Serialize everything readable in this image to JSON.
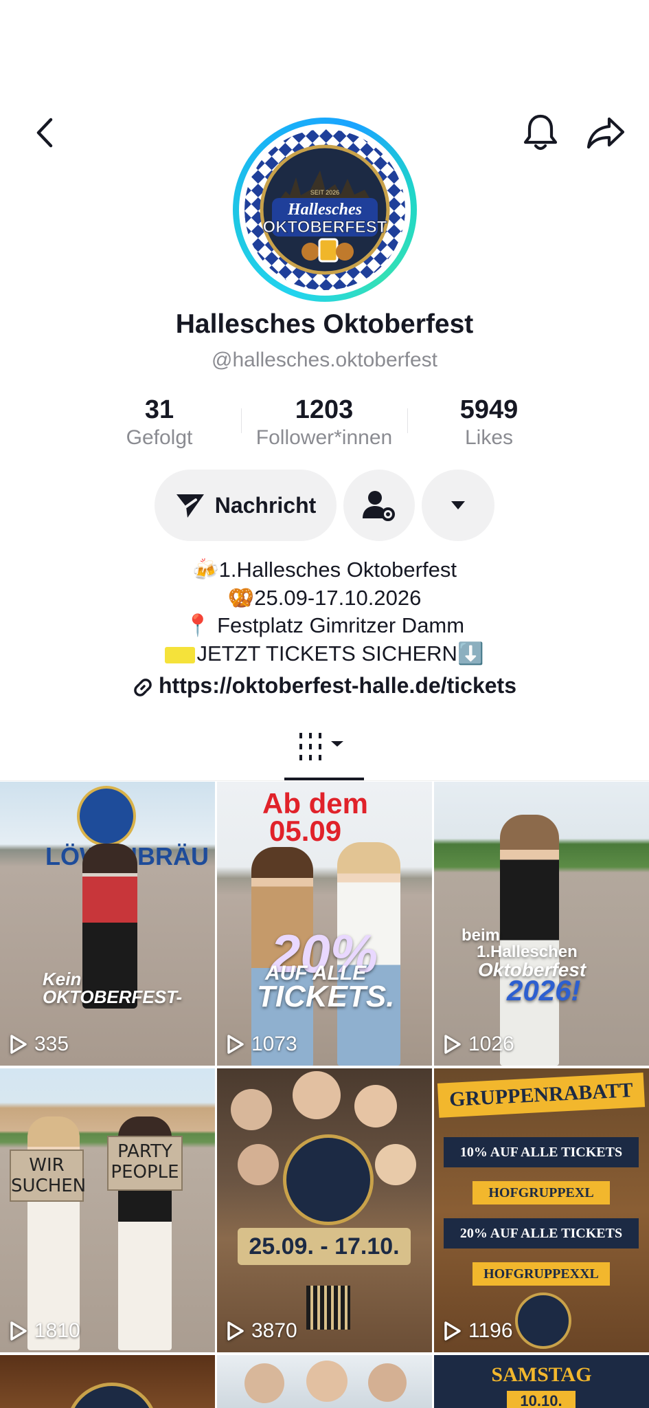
{
  "header": {
    "back_icon": "chevron-left-icon",
    "bell_icon": "bell-icon",
    "share_icon": "share-arrow-icon"
  },
  "profile": {
    "display_name": "Hallesches Oktoberfest",
    "handle": "@hallesches.oktoberfest",
    "logo_text_top": "SEIT 2026",
    "logo_text_1": "Hallesches",
    "logo_text_2": "OKTOBERFEST"
  },
  "stats": [
    {
      "value": "31",
      "label": "Gefolgt"
    },
    {
      "value": "1203",
      "label": "Follower*innen"
    },
    {
      "value": "5949",
      "label": "Likes"
    }
  ],
  "actions": {
    "message_label": "Nachricht",
    "user_settings_icon": "user-gear-icon",
    "dropdown_icon": "caret-down-icon"
  },
  "bio": {
    "line1": "🍻1.Hallesches Oktoberfest",
    "line2": "🥨25.09-17.10.2026",
    "line3": "📍 Festplatz Gimritzer Damm",
    "line4": "JETZT TICKETS SICHERN⬇️",
    "link": "https://oktoberfest-halle.de/tickets"
  },
  "tabs": {
    "grid_icon": "grid-bars-icon"
  },
  "videos": [
    {
      "views": "335",
      "overlay_1": "LÖWENBRÄU",
      "overlay_2": "Kein",
      "overlay_3": "OKTOBERFEST-"
    },
    {
      "views": "1073",
      "overlay_1": "Ab dem",
      "overlay_2": "05.09",
      "overlay_3": "20%",
      "overlay_4": "AUF ALLE",
      "overlay_5": "TICKETS."
    },
    {
      "views": "1026",
      "overlay_1": "beim",
      "overlay_2": "1.Halleschen",
      "overlay_3": "Oktoberfest",
      "overlay_4": "2026!"
    },
    {
      "views": "1810",
      "overlay_1": "WIR SUCHEN",
      "overlay_2": "PARTY PEOPLE"
    },
    {
      "views": "3870",
      "overlay_1": "25.09. - 17.10."
    },
    {
      "views": "1196",
      "overlay_1": "GRUPPENRABATT",
      "overlay_2": "10% AUF ALLE TICKETS",
      "overlay_3": "HOFGRUPPEXL",
      "overlay_4": "20% AUF ALLE TICKETS",
      "overlay_5": "HOFGRUPPEXXL"
    },
    {
      "views": ""
    },
    {
      "views": ""
    },
    {
      "views": "",
      "overlay_1": "SAMSTAG",
      "overlay_2": "10.10."
    }
  ],
  "colors": {
    "accent_ring": "#22d3ee",
    "pill_bg": "#f1f1f2",
    "muted_text": "#8a8b91"
  }
}
